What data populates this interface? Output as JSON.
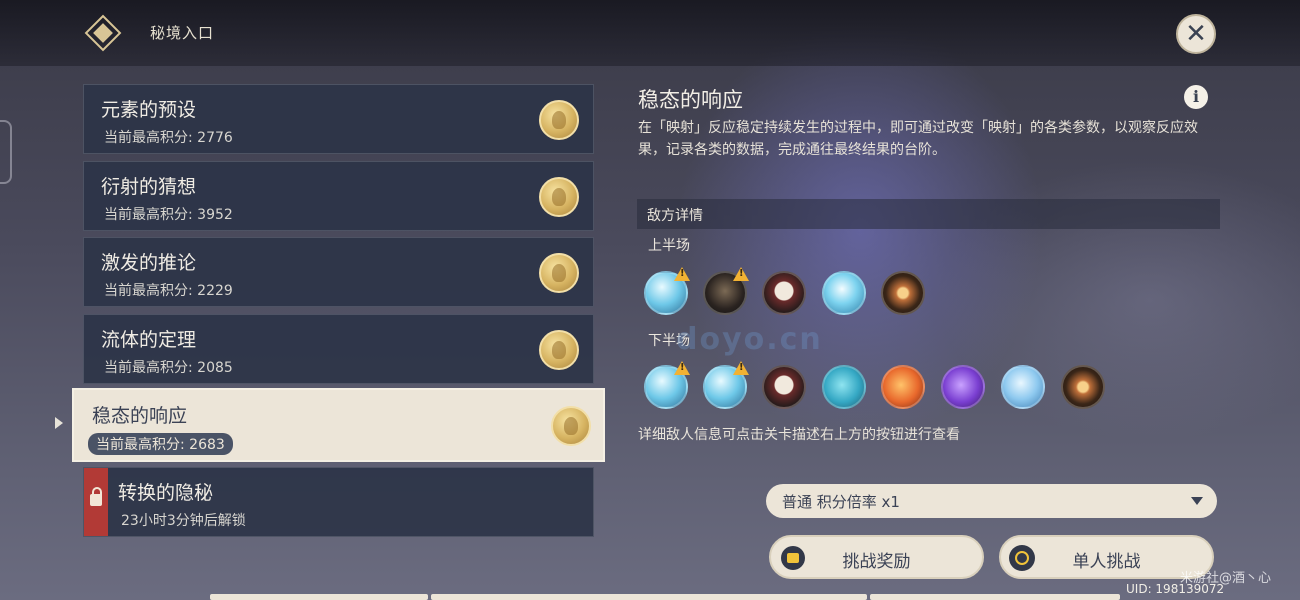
{
  "header": {
    "title": "秘境入口",
    "close_icon": "close-x-icon"
  },
  "levels": [
    {
      "name": "元素的预设",
      "score_label": "当前最高积分: 2776",
      "state": "normal"
    },
    {
      "name": "衍射的猜想",
      "score_label": "当前最高积分: 3952",
      "state": "normal"
    },
    {
      "name": "激发的推论",
      "score_label": "当前最高积分: 2229",
      "state": "normal"
    },
    {
      "name": "流体的定理",
      "score_label": "当前最高积分: 2085",
      "state": "normal"
    },
    {
      "name": "稳态的响应",
      "score_label": "当前最高积分: 2683",
      "state": "selected"
    },
    {
      "name": "转换的隐秘",
      "score_label": "23小时3分钟后解锁",
      "state": "locked"
    }
  ],
  "detail": {
    "title": "稳态的响应",
    "description": "在「映射」反应稳定持续发生的过程中，即可通过改变「映射」的各类参数，以观察反应效果，记录各类的数据，完成通往最终结果的台阶。",
    "enemy_section": "敌方详情",
    "first_half_label": "上半场",
    "second_half_label": "下半场",
    "first_half_enemies": [
      "cryo-slime-icon",
      "dark-hilichurl-icon",
      "masked-hilichurl-icon",
      "cryo-slime-icon",
      "geo-core-icon"
    ],
    "second_half_enemies": [
      "cryo-slime-icon",
      "cryo-slime-icon",
      "masked-hilichurl-icon",
      "hydro-slime-icon",
      "pyro-slime-icon",
      "electro-slime-icon",
      "cryo-crystal-icon",
      "geo-core-icon"
    ],
    "hint": "详细敌人信息可点击关卡描述右上方的按钮进行查看"
  },
  "mode_select": {
    "value": "普通 积分倍率 x1"
  },
  "buttons": {
    "reward": "挑战奖励",
    "solo": "单人挑战"
  },
  "uid": "UID: 198139072",
  "watermarks": {
    "user": "米游社@酒丶心",
    "site": "doyo.cn"
  },
  "colors": {
    "card_bg": "#2c3448",
    "selected_bg": "#ece5d8",
    "lock_red": "#b23a36",
    "coin_gold": "#d6b361"
  }
}
